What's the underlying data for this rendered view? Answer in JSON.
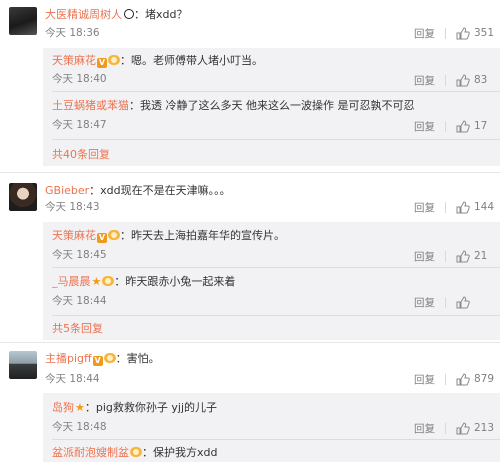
{
  "comments": [
    {
      "name": "大医精诚周树人",
      "text": "：堵xdd？",
      "time": "今天 18:36",
      "reply": "回复",
      "likes": "351",
      "subs": [
        {
          "name": "天策麻花",
          "text": "：嗯。老师傅带人堵小叮当。",
          "time": "今天 18:40",
          "reply": "回复",
          "likes": "83"
        },
        {
          "name": "土豆蜗猪或苯猫",
          "text": "：我透 冷静了这么多天 他来这么一波操作 是可忍孰不可忍",
          "time": "今天 18:47",
          "reply": "回复",
          "likes": "17"
        }
      ],
      "more": "共40条回复"
    },
    {
      "name": "GBieber",
      "text": "：xdd现在不是在天津嘛。。。",
      "time": "今天 18:43",
      "reply": "回复",
      "likes": "144",
      "subs": [
        {
          "name": "天策麻花",
          "text": "：昨天去上海拍嘉年华的宣传片。",
          "time": "今天 18:45",
          "reply": "回复",
          "likes": "21"
        },
        {
          "name": "_马晨晨",
          "text": "：昨天跟赤小兔一起来着",
          "time": "今天 18:44",
          "reply": "回复",
          "likes": ""
        }
      ],
      "more": "共5条回复"
    },
    {
      "name": "主播pigff",
      "text": "：害怕。",
      "time": "今天 18:44",
      "reply": "回复",
      "likes": "879",
      "subs": [
        {
          "name": "岛狗",
          "text": "：pig救救你孙子 yjj的儿子",
          "time": "今天 18:48",
          "reply": "回复",
          "likes": "213"
        },
        {
          "name": "盆派耐泡嫂制盆",
          "text": "：保护我方xdd",
          "time": "",
          "reply": "",
          "likes": ""
        }
      ]
    }
  ]
}
